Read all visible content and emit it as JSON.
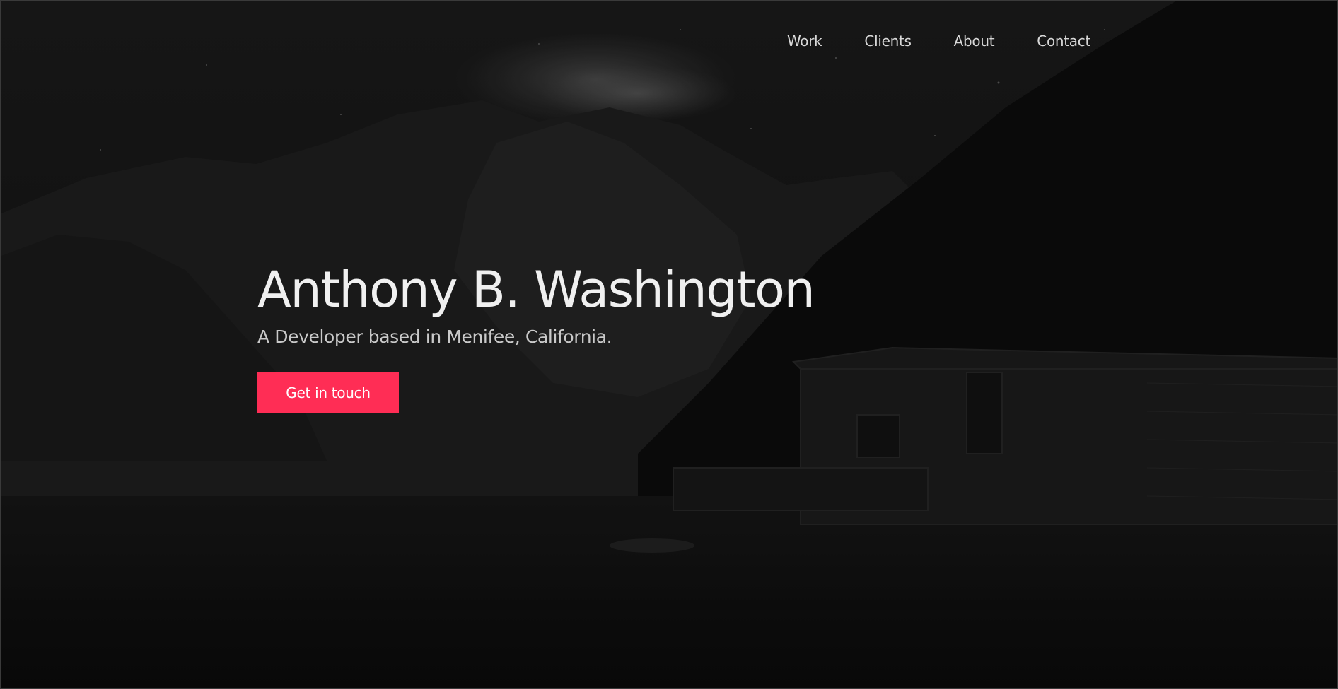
{
  "nav": {
    "items": [
      {
        "label": "Work"
      },
      {
        "label": "Clients"
      },
      {
        "label": "About"
      },
      {
        "label": "Contact"
      }
    ]
  },
  "hero": {
    "title": "Anthony B. Washington",
    "subtitle": "A Developer based in Menifee, California.",
    "cta_label": "Get in touch"
  },
  "colors": {
    "accent": "#ff2d55",
    "background": "#0d0d0d",
    "text_primary": "#f0f0f0",
    "text_secondary": "#c9c9c9"
  }
}
